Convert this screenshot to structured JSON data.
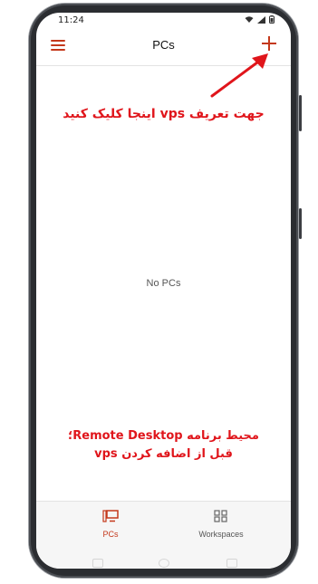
{
  "status_bar": {
    "time": "11:24"
  },
  "app_bar": {
    "title": "PCs",
    "menu_icon": "hamburger-menu-icon",
    "add_icon": "plus-icon"
  },
  "main": {
    "empty_text": "No PCs"
  },
  "annotations": {
    "top_text": "جهت تعریف vps اینجا کلیک کنید",
    "bottom_line1": "محیط برنامه Remote Desktop؛",
    "bottom_line2": "قبل از اضافه کردن vps",
    "color": "#e0151b"
  },
  "bottom_nav": {
    "items": [
      {
        "label": "PCs",
        "icon": "computer-icon",
        "active": true
      },
      {
        "label": "Workspaces",
        "icon": "workspaces-icon",
        "active": false
      }
    ]
  },
  "colors": {
    "accent": "#c4381b",
    "annotation": "#e0151b",
    "frame": "#2b2d31"
  }
}
